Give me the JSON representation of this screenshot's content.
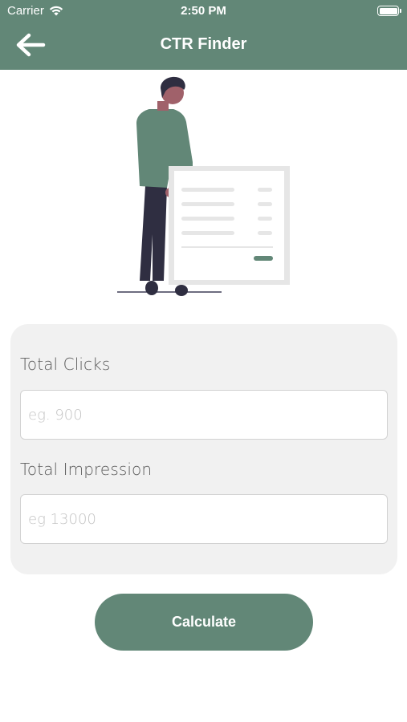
{
  "status_bar": {
    "carrier": "Carrier",
    "time": "2:50 PM",
    "battery_level": 1.0
  },
  "header": {
    "title": "CTR Finder",
    "back_icon": "arrow-left-icon"
  },
  "form": {
    "clicks": {
      "label": "Total Clicks",
      "placeholder": "eg. 900",
      "value": ""
    },
    "impressions": {
      "label": "Total Impression",
      "placeholder": "eg 13000",
      "value": ""
    }
  },
  "actions": {
    "calculate_label": "Calculate"
  },
  "colors": {
    "primary": "#628777",
    "card": "#f1f1f1",
    "text_label": "#5b5b5b",
    "placeholder": "#c4c4c4"
  }
}
